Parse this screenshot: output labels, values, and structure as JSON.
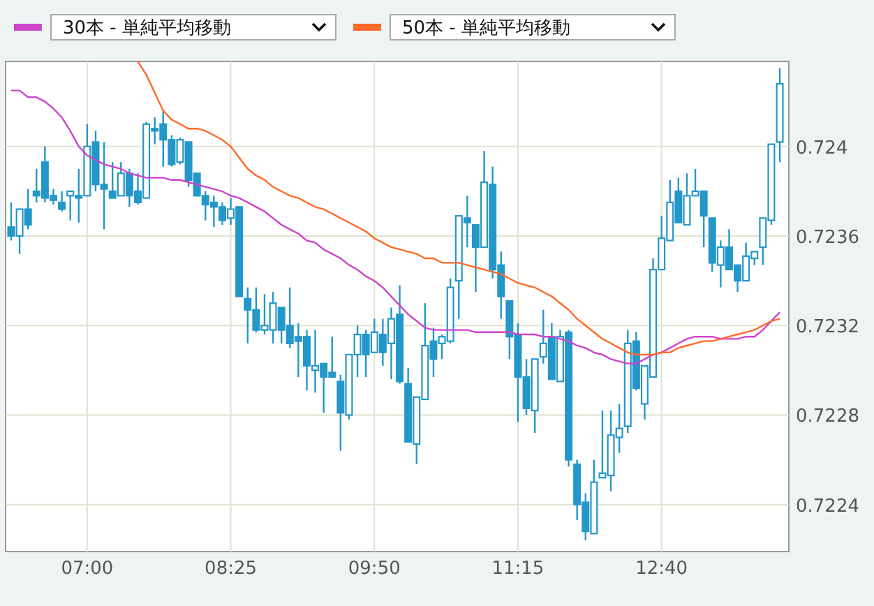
{
  "chart": {
    "chart_data": {
      "type": "candlestick",
      "grid": true,
      "ylim": [
        0.72219,
        0.72438
      ],
      "categories": [
        null,
        null,
        null,
        null,
        null,
        null,
        null,
        null,
        null,
        "07:00",
        null,
        null,
        null,
        null,
        null,
        null,
        null,
        null,
        null,
        null,
        null,
        null,
        null,
        null,
        null,
        null,
        "08:25",
        null,
        null,
        null,
        null,
        null,
        null,
        null,
        null,
        null,
        null,
        null,
        null,
        null,
        null,
        null,
        null,
        "09:50",
        null,
        null,
        null,
        null,
        null,
        null,
        null,
        null,
        null,
        null,
        null,
        null,
        null,
        null,
        null,
        null,
        "11:15",
        null,
        null,
        null,
        null,
        null,
        null,
        null,
        null,
        null,
        null,
        null,
        null,
        null,
        null,
        null,
        null,
        "12:40",
        null,
        null,
        null,
        null,
        null,
        null,
        null,
        null,
        null,
        null,
        null,
        null,
        null,
        null
      ],
      "yticks": [
        0.724,
        0.7236,
        0.7232,
        0.7228,
        0.7224
      ],
      "series": [
        {
          "name": "30本 - 単純平均移動",
          "type": "line",
          "color": "#cc44cc",
          "values": [
            0.72425,
            0.72425,
            0.72422,
            0.72422,
            0.7242,
            0.72417,
            0.72413,
            0.72407,
            0.724,
            0.72396,
            0.72394,
            0.72392,
            0.72391,
            0.7239,
            0.72388,
            0.72387,
            0.72386,
            0.72386,
            0.72386,
            0.72385,
            0.72385,
            0.72384,
            0.72383,
            0.72382,
            0.72381,
            0.7238,
            0.72378,
            0.72377,
            0.72375,
            0.72373,
            0.72371,
            0.72368,
            0.72365,
            0.72363,
            0.72361,
            0.72358,
            0.72357,
            0.72354,
            0.72352,
            0.7235,
            0.72347,
            0.72345,
            0.72342,
            0.7234,
            0.72337,
            0.72333,
            0.72329,
            0.72325,
            0.72322,
            0.72319,
            0.72318,
            0.72318,
            0.72318,
            0.72318,
            0.72318,
            0.72317,
            0.72317,
            0.72317,
            0.72317,
            0.72317,
            0.72316,
            0.72316,
            0.72316,
            0.72315,
            0.72315,
            0.72314,
            0.72313,
            0.72311,
            0.7231,
            0.72308,
            0.72307,
            0.72305,
            0.72304,
            0.72303,
            0.72303,
            0.72305,
            0.72307,
            0.72308,
            0.7231,
            0.72312,
            0.72314,
            0.72315,
            0.72315,
            0.72315,
            0.72314,
            0.72314,
            0.72314,
            0.72315,
            0.72315,
            0.72318,
            0.72322,
            0.72326
          ]
        },
        {
          "name": "50本 - 単純平均移動",
          "type": "line",
          "color": "#ff6a2a",
          "values": [
            null,
            null,
            null,
            null,
            null,
            null,
            null,
            null,
            null,
            null,
            null,
            null,
            null,
            null,
            null,
            0.72438,
            0.72432,
            0.72424,
            0.72416,
            0.72412,
            0.7241,
            0.72408,
            0.72408,
            0.72407,
            0.72405,
            0.72403,
            0.724,
            0.72395,
            0.7239,
            0.72387,
            0.72385,
            0.72382,
            0.7238,
            0.72378,
            0.72377,
            0.72375,
            0.72373,
            0.72372,
            0.7237,
            0.72368,
            0.72366,
            0.72364,
            0.72362,
            0.72359,
            0.72357,
            0.72355,
            0.72354,
            0.72353,
            0.72352,
            0.7235,
            0.7235,
            0.72348,
            0.72348,
            0.72348,
            0.72347,
            0.72346,
            0.72345,
            0.72344,
            0.72343,
            0.72341,
            0.72339,
            0.72338,
            0.72337,
            0.72335,
            0.72333,
            0.7233,
            0.72327,
            0.72323,
            0.7232,
            0.72317,
            0.72314,
            0.72312,
            0.7231,
            0.72308,
            0.72307,
            0.72307,
            0.72307,
            0.72308,
            0.72308,
            0.7231,
            0.72311,
            0.72312,
            0.72313,
            0.72313,
            0.72314,
            0.72315,
            0.72316,
            0.72317,
            0.72318,
            0.7232,
            0.72322,
            0.72323
          ]
        }
      ],
      "ohlc": [
        [
          0.72364,
          0.72375,
          0.72358,
          0.7236
        ],
        [
          0.7236,
          0.72372,
          0.72352,
          0.72372
        ],
        [
          0.72372,
          0.72381,
          0.72363,
          0.72365
        ],
        [
          0.7238,
          0.7239,
          0.72375,
          0.72378
        ],
        [
          0.72393,
          0.724,
          0.72375,
          0.72377
        ],
        [
          0.72378,
          0.72381,
          0.72374,
          0.72376
        ],
        [
          0.72375,
          0.7238,
          0.72371,
          0.72372
        ],
        [
          0.72378,
          0.7238,
          0.72367,
          0.7238
        ],
        [
          0.72378,
          0.7239,
          0.72366,
          0.72377
        ],
        [
          0.72378,
          0.7241,
          0.72378,
          0.724
        ],
        [
          0.72402,
          0.72407,
          0.7238,
          0.72383
        ],
        [
          0.72383,
          0.72402,
          0.72363,
          0.72381
        ],
        [
          0.7238,
          0.72393,
          0.72377,
          0.72377
        ],
        [
          0.72378,
          0.72393,
          0.72378,
          0.72388
        ],
        [
          0.72388,
          0.7239,
          0.72373,
          0.72378
        ],
        [
          0.7238,
          0.72388,
          0.72374,
          0.72375
        ],
        [
          0.72377,
          0.72411,
          0.72377,
          0.7241
        ],
        [
          0.72408,
          0.72413,
          0.72401,
          0.72407
        ],
        [
          0.7241,
          0.72416,
          0.72391,
          0.72403
        ],
        [
          0.72403,
          0.72405,
          0.72391,
          0.72392
        ],
        [
          0.72393,
          0.72404,
          0.72392,
          0.72403
        ],
        [
          0.72402,
          0.72402,
          0.72382,
          0.72385
        ],
        [
          0.72388,
          0.72388,
          0.72378,
          0.72378
        ],
        [
          0.72378,
          0.7238,
          0.72367,
          0.72374
        ],
        [
          0.72375,
          0.72378,
          0.72364,
          0.72373
        ],
        [
          0.72373,
          0.72375,
          0.72365,
          0.72367
        ],
        [
          0.72368,
          0.72377,
          0.72365,
          0.72372
        ],
        [
          0.72373,
          0.72373,
          0.72333,
          0.72333
        ],
        [
          0.72332,
          0.72337,
          0.72312,
          0.72327
        ],
        [
          0.72327,
          0.72337,
          0.72317,
          0.72318
        ],
        [
          0.72318,
          0.72334,
          0.72316,
          0.7232
        ],
        [
          0.72318,
          0.72335,
          0.72312,
          0.7233
        ],
        [
          0.72328,
          0.72328,
          0.72312,
          0.72318
        ],
        [
          0.7232,
          0.72337,
          0.7231,
          0.72312
        ],
        [
          0.72315,
          0.72321,
          0.72297,
          0.72313
        ],
        [
          0.72315,
          0.72318,
          0.72291,
          0.72302
        ],
        [
          0.723,
          0.72318,
          0.7229,
          0.72302
        ],
        [
          0.72303,
          0.72303,
          0.72281,
          0.72297
        ],
        [
          0.72299,
          0.72315,
          0.72297,
          0.72297
        ],
        [
          0.72295,
          0.72298,
          0.72264,
          0.72281
        ],
        [
          0.7228,
          0.72307,
          0.72278,
          0.72307
        ],
        [
          0.72307,
          0.7232,
          0.72297,
          0.72316
        ],
        [
          0.72316,
          0.72318,
          0.72297,
          0.72307
        ],
        [
          0.72308,
          0.72323,
          0.72308,
          0.72317
        ],
        [
          0.72316,
          0.72323,
          0.72302,
          0.72308
        ],
        [
          0.72312,
          0.72328,
          0.72296,
          0.72323
        ],
        [
          0.72325,
          0.72338,
          0.72294,
          0.72295
        ],
        [
          0.72294,
          0.72301,
          0.72268,
          0.72268
        ],
        [
          0.72267,
          0.72288,
          0.72258,
          0.72288
        ],
        [
          0.72287,
          0.7233,
          0.72287,
          0.72311
        ],
        [
          0.72313,
          0.72319,
          0.72297,
          0.72305
        ],
        [
          0.72312,
          0.72316,
          0.72305,
          0.72315
        ],
        [
          0.72313,
          0.72341,
          0.72312,
          0.72337
        ],
        [
          0.7234,
          0.72369,
          0.72323,
          0.72369
        ],
        [
          0.72368,
          0.72378,
          0.72355,
          0.72366
        ],
        [
          0.72365,
          0.72365,
          0.72335,
          0.72355
        ],
        [
          0.72355,
          0.72398,
          0.72355,
          0.72384
        ],
        [
          0.72383,
          0.72391,
          0.72341,
          0.72345
        ],
        [
          0.72347,
          0.72353,
          0.72323,
          0.72333
        ],
        [
          0.72331,
          0.72331,
          0.72305,
          0.72315
        ],
        [
          0.72316,
          0.72321,
          0.72277,
          0.72297
        ],
        [
          0.72297,
          0.72305,
          0.7228,
          0.72283
        ],
        [
          0.72282,
          0.72305,
          0.72272,
          0.72305
        ],
        [
          0.72306,
          0.72327,
          0.72303,
          0.72312
        ],
        [
          0.72315,
          0.72321,
          0.72296,
          0.72296
        ],
        [
          0.72295,
          0.72318,
          0.72295,
          0.72315
        ],
        [
          0.72317,
          0.72318,
          0.72257,
          0.7226
        ],
        [
          0.72258,
          0.7226,
          0.72233,
          0.7224
        ],
        [
          0.72241,
          0.72245,
          0.72224,
          0.72228
        ],
        [
          0.72227,
          0.7226,
          0.72227,
          0.7225
        ],
        [
          0.72252,
          0.72282,
          0.72252,
          0.72254
        ],
        [
          0.72253,
          0.72282,
          0.72246,
          0.72271
        ],
        [
          0.7227,
          0.72285,
          0.72263,
          0.72274
        ],
        [
          0.72275,
          0.72318,
          0.72272,
          0.72312
        ],
        [
          0.72313,
          0.72317,
          0.72291,
          0.72292
        ],
        [
          0.72285,
          0.72302,
          0.72278,
          0.72302
        ],
        [
          0.72297,
          0.7235,
          0.72297,
          0.72345
        ],
        [
          0.72345,
          0.72369,
          0.72345,
          0.72359
        ],
        [
          0.72358,
          0.72385,
          0.72358,
          0.72375
        ],
        [
          0.7238,
          0.72386,
          0.72366,
          0.72366
        ],
        [
          0.72365,
          0.72388,
          0.72365,
          0.72378
        ],
        [
          0.72378,
          0.7239,
          0.72378,
          0.7238
        ],
        [
          0.7238,
          0.7238,
          0.72355,
          0.72369
        ],
        [
          0.72368,
          0.72368,
          0.72344,
          0.72348
        ],
        [
          0.72347,
          0.72358,
          0.72337,
          0.72355
        ],
        [
          0.72355,
          0.72363,
          0.72345,
          0.72345
        ],
        [
          0.72347,
          0.72347,
          0.72335,
          0.7234
        ],
        [
          0.7234,
          0.72357,
          0.7234,
          0.72351
        ],
        [
          0.7235,
          0.72353,
          0.72347,
          0.72353
        ],
        [
          0.72355,
          0.72368,
          0.72347,
          0.72368
        ],
        [
          0.72367,
          0.72401,
          0.72365,
          0.72401
        ],
        [
          0.72402,
          0.72435,
          0.72393,
          0.72428
        ]
      ]
    }
  }
}
